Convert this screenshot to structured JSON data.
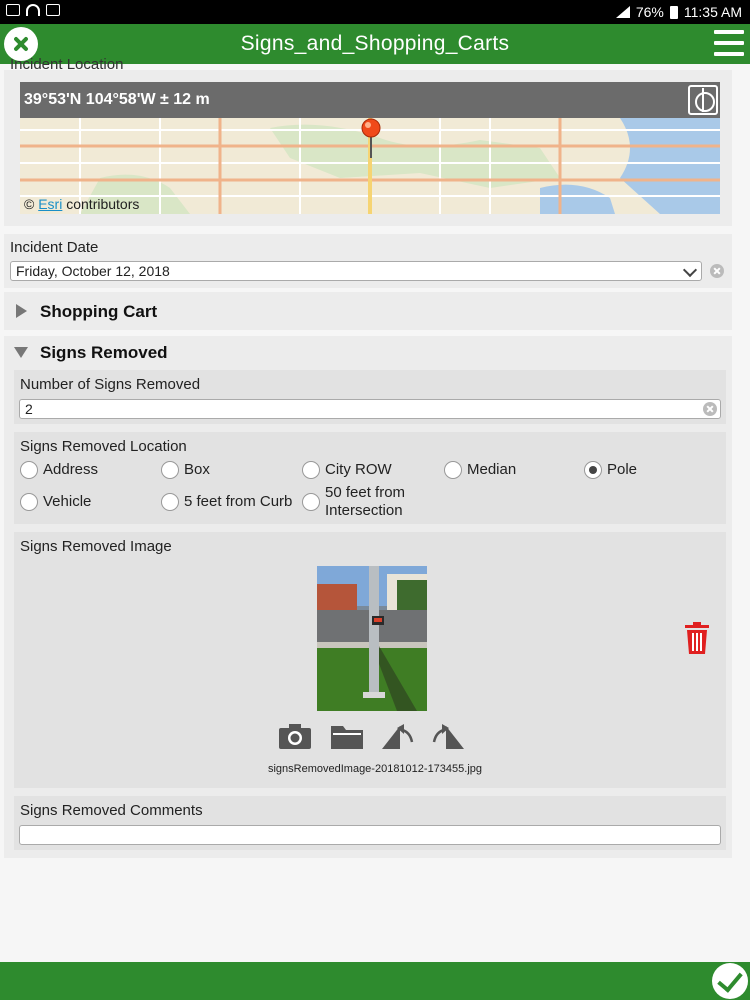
{
  "status_bar": {
    "battery": "76%",
    "time": "11:35 AM"
  },
  "app": {
    "title": "Signs_and_Shopping_Carts"
  },
  "incident_location": {
    "label_partial": "Incident Location",
    "coordinates": "39°53'N 104°58'W ± 12 m",
    "attribution_prefix": "©",
    "attribution_link": "Esri",
    "attribution_suffix": "contributors"
  },
  "incident_date": {
    "label": "Incident Date",
    "value": "Friday, October 12, 2018"
  },
  "groups": {
    "shopping_cart": {
      "title": "Shopping Cart",
      "expanded": false
    },
    "signs_removed": {
      "title": "Signs Removed",
      "expanded": true
    }
  },
  "number_of_signs": {
    "label": "Number of Signs Removed",
    "value": "2"
  },
  "signs_location": {
    "label": "Signs Removed Location",
    "options": [
      {
        "label": "Address",
        "selected": false
      },
      {
        "label": "Box",
        "selected": false
      },
      {
        "label": "City ROW",
        "selected": false
      },
      {
        "label": "Median",
        "selected": false
      },
      {
        "label": "Pole",
        "selected": true
      },
      {
        "label": "Vehicle",
        "selected": false
      },
      {
        "label": "5 feet from Curb",
        "selected": false
      },
      {
        "label": "50 feet from Intersection",
        "selected": false
      }
    ]
  },
  "signs_image": {
    "label": "Signs Removed Image",
    "filename": "signsRemovedImage-20181012-173455.jpg"
  },
  "signs_comments": {
    "label": "Signs Removed Comments",
    "value": ""
  },
  "colors": {
    "brand_green": "#2e8b2e",
    "delete_red": "#e02020",
    "link_blue": "#1a8fc7"
  }
}
